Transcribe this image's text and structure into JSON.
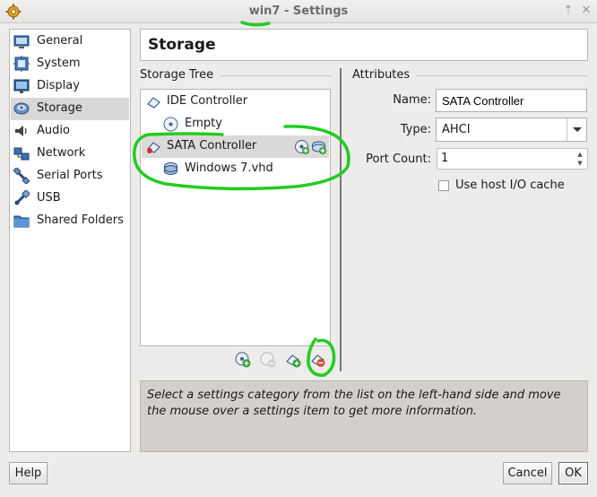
{
  "window": {
    "title_vm": "win7",
    "title_rest": " - Settings",
    "colors": {
      "annotation": "#22cc22",
      "background": "#edeceb",
      "selected_row": "#d9d8d6"
    }
  },
  "sidebar": {
    "items": [
      {
        "label": "General",
        "icon": "general-icon"
      },
      {
        "label": "System",
        "icon": "system-icon"
      },
      {
        "label": "Display",
        "icon": "display-icon"
      },
      {
        "label": "Storage",
        "icon": "storage-icon",
        "selected": true
      },
      {
        "label": "Audio",
        "icon": "audio-icon"
      },
      {
        "label": "Network",
        "icon": "network-icon"
      },
      {
        "label": "Serial Ports",
        "icon": "serial-port-icon"
      },
      {
        "label": "USB",
        "icon": "usb-icon"
      },
      {
        "label": "Shared Folders",
        "icon": "shared-folder-icon"
      }
    ]
  },
  "page": {
    "title": "Storage"
  },
  "storage_tree": {
    "label": "Storage Tree",
    "rows": [
      {
        "label": "IDE Controller",
        "icon": "ide-controller-icon"
      },
      {
        "label": "Empty",
        "icon": "cd-disc-icon"
      },
      {
        "label": "SATA Controller",
        "icon": "sata-controller-icon",
        "selected": true
      },
      {
        "label": "Windows 7.vhd",
        "icon": "hard-disk-icon"
      }
    ],
    "toolbar": [
      "add-attachment-icon",
      "remove-attachment-icon",
      "add-controller-icon",
      "remove-controller-icon"
    ]
  },
  "attributes": {
    "label": "Attributes",
    "name_label": "Name:",
    "name_value": "SATA Controller",
    "type_label": "Type:",
    "type_value": "AHCI",
    "port_count_label": "Port Count:",
    "port_count_value": "1",
    "host_io_label": "Use host I/O cache",
    "host_io_checked": false
  },
  "info": {
    "text": "Select a settings category from the list on the left-hand side and move the mouse over a settings item to get more information."
  },
  "buttons": {
    "help": "Help",
    "cancel": "Cancel",
    "ok": "OK"
  }
}
